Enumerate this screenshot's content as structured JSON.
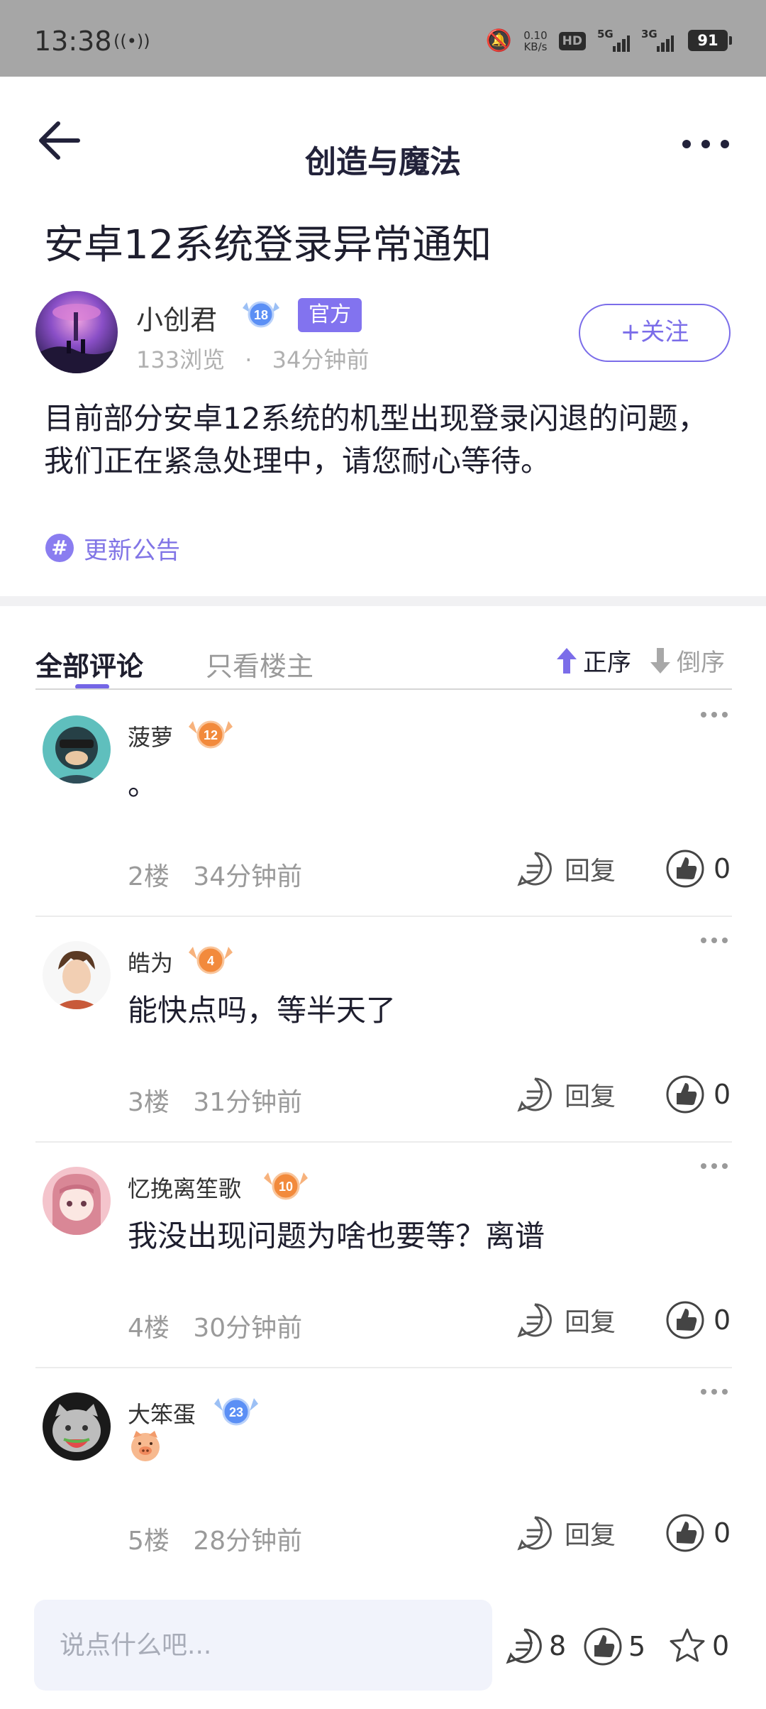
{
  "status_bar": {
    "time": "13:38",
    "net_speed_value": "0.10",
    "net_speed_unit": "KB/s",
    "hd": "HD",
    "signal1": "5G",
    "signal2": "3G",
    "battery": "91"
  },
  "header": {
    "title": "创造与魔法"
  },
  "post": {
    "title": "安卓12系统登录异常通知",
    "author": "小创君",
    "author_level": "18",
    "official_tag": "官方",
    "views": "133浏览",
    "dot": "·",
    "time": "34分钟前",
    "follow_label": "+关注",
    "body": "目前部分安卓12系统的机型出现登录闪退的问题，我们正在紧急处理中，请您耐心等待。",
    "topic": "更新公告"
  },
  "tabs": {
    "all": "全部评论",
    "owner_only": "只看楼主",
    "sort_asc": "正序",
    "sort_desc": "倒序"
  },
  "comments": [
    {
      "name": "菠萝",
      "level": "12",
      "text": "。",
      "floor": "2楼",
      "time": "34分钟前",
      "reply": "回复",
      "likes": "0"
    },
    {
      "name": "皓为",
      "level": "4",
      "text": "能快点吗，等半天了",
      "floor": "3楼",
      "time": "31分钟前",
      "reply": "回复",
      "likes": "0"
    },
    {
      "name": "忆挽离笙歌",
      "level": "10",
      "text": "我没出现问题为啥也要等？离谱",
      "floor": "4楼",
      "time": "30分钟前",
      "reply": "回复",
      "likes": "0"
    },
    {
      "name": "大笨蛋",
      "level": "23",
      "text": "",
      "floor": "5楼",
      "time": "28分钟前",
      "reply": "回复",
      "likes": "0"
    }
  ],
  "bottom_bar": {
    "placeholder": "说点什么吧...",
    "comment_count": "8",
    "like_count": "5",
    "star_count": "0"
  },
  "colors": {
    "accent": "#7b6de9",
    "official_bg": "#8273ef",
    "status_bar_bg": "#a6a6a6",
    "badge_orange": "#f28a3c",
    "badge_blue": "#5b8ff5"
  },
  "icons": [
    "back-arrow-icon",
    "more-icon",
    "hash-icon",
    "arrow-up-icon",
    "arrow-down-icon",
    "comment-icon",
    "like-icon",
    "star-icon"
  ]
}
